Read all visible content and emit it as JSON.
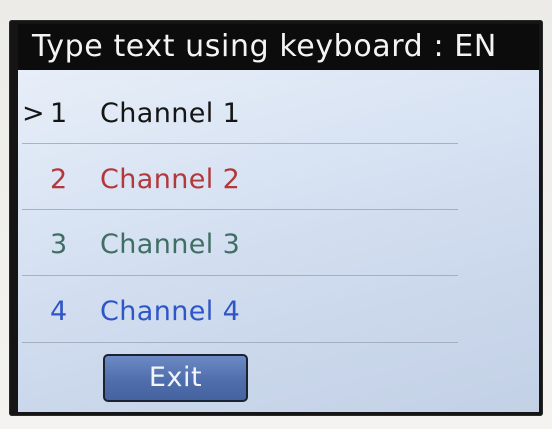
{
  "header": {
    "title": "Type text using keyboard : EN"
  },
  "menu": {
    "cursor": ">",
    "items": [
      {
        "number": "1",
        "label": "Channel 1",
        "color": "#151515"
      },
      {
        "number": "2",
        "label": "Channel 2",
        "color": "#b2383b"
      },
      {
        "number": "3",
        "label": "Channel 3",
        "color": "#3f6e63"
      },
      {
        "number": "4",
        "label": "Channel 4",
        "color": "#2e56c6"
      }
    ],
    "selected_index": 0
  },
  "footer": {
    "exit_label": "Exit"
  }
}
